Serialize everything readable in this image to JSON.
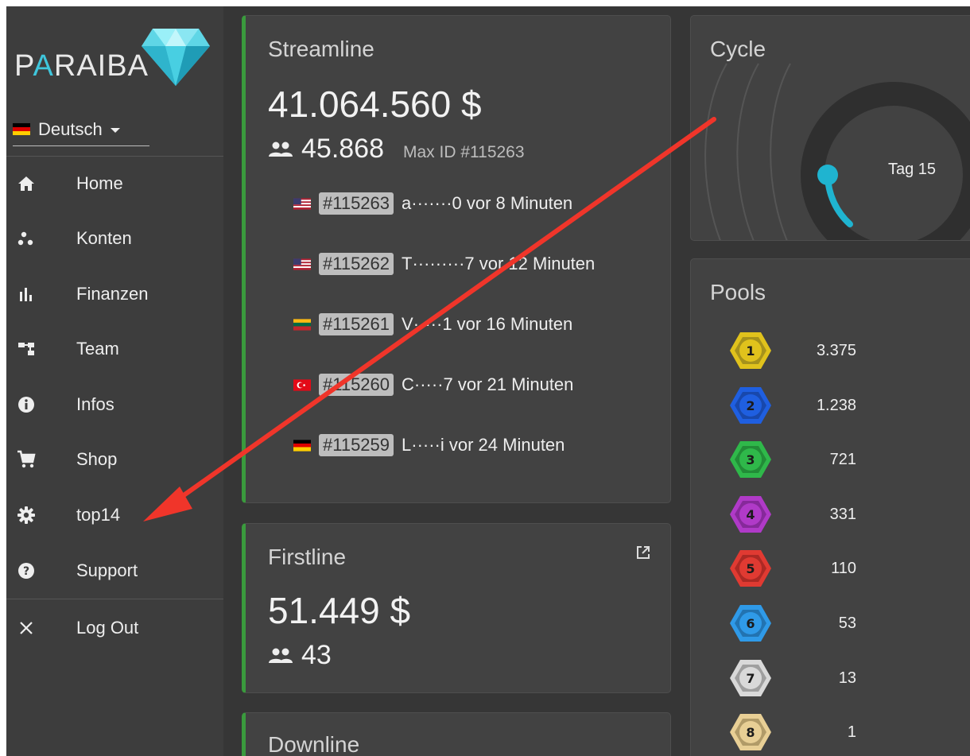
{
  "brand": {
    "logo_text_1": "P",
    "logo_text_accent": "A",
    "logo_text_2": "RAIBA"
  },
  "language": {
    "label": "Deutsch",
    "flag": "de"
  },
  "nav": [
    {
      "label": "Home",
      "icon": "home-icon"
    },
    {
      "label": "Konten",
      "icon": "accounts-icon"
    },
    {
      "label": "Finanzen",
      "icon": "bar-chart-icon"
    },
    {
      "label": "Team",
      "icon": "org-chart-icon"
    },
    {
      "label": "Infos",
      "icon": "info-icon"
    },
    {
      "label": "Shop",
      "icon": "cart-icon"
    },
    {
      "label": "top14",
      "icon": "gear-icon"
    },
    {
      "label": "Support",
      "icon": "help-icon"
    }
  ],
  "logout": {
    "label": "Log Out",
    "icon": "close-icon"
  },
  "streamline": {
    "title": "Streamline",
    "amount": "41.064.560 $",
    "people": "45.868",
    "max_id": "Max ID #115263",
    "members": [
      {
        "flag": "us",
        "id": "#115263",
        "text": "a·······0 vor 8 Minuten"
      },
      {
        "flag": "us",
        "id": "#115262",
        "text": "T·········7 vor 12 Minuten"
      },
      {
        "flag": "lt",
        "id": "#115261",
        "text": "V·····1 vor 16 Minuten"
      },
      {
        "flag": "tr",
        "id": "#115260",
        "text": "C·····7 vor 21 Minuten"
      },
      {
        "flag": "de",
        "id": "#115259",
        "text": "L·····i vor 24 Minuten"
      }
    ]
  },
  "firstline": {
    "title": "Firstline",
    "amount": "51.449 $",
    "people": "43"
  },
  "downline": {
    "title": "Downline"
  },
  "cycle": {
    "title": "Cycle",
    "day_label": "Tag 15"
  },
  "pools": {
    "title": "Pools",
    "items": [
      {
        "number": "1",
        "value": "3.375",
        "color": "#e0c21c"
      },
      {
        "number": "2",
        "value": "1.238",
        "color": "#1f5fe0"
      },
      {
        "number": "3",
        "value": "721",
        "color": "#2fb84a"
      },
      {
        "number": "4",
        "value": "331",
        "color": "#b03ac8"
      },
      {
        "number": "5",
        "value": "110",
        "color": "#e03a32"
      },
      {
        "number": "6",
        "value": "53",
        "color": "#2f9ae8"
      },
      {
        "number": "7",
        "value": "13",
        "color": "#d9d9d9"
      },
      {
        "number": "8",
        "value": "1",
        "color": "#e8cf95"
      }
    ]
  },
  "colors": {
    "accent_green": "#3a9a3d",
    "cycle_blue": "#1fb4d0",
    "annotation_red": "#f0352a"
  }
}
